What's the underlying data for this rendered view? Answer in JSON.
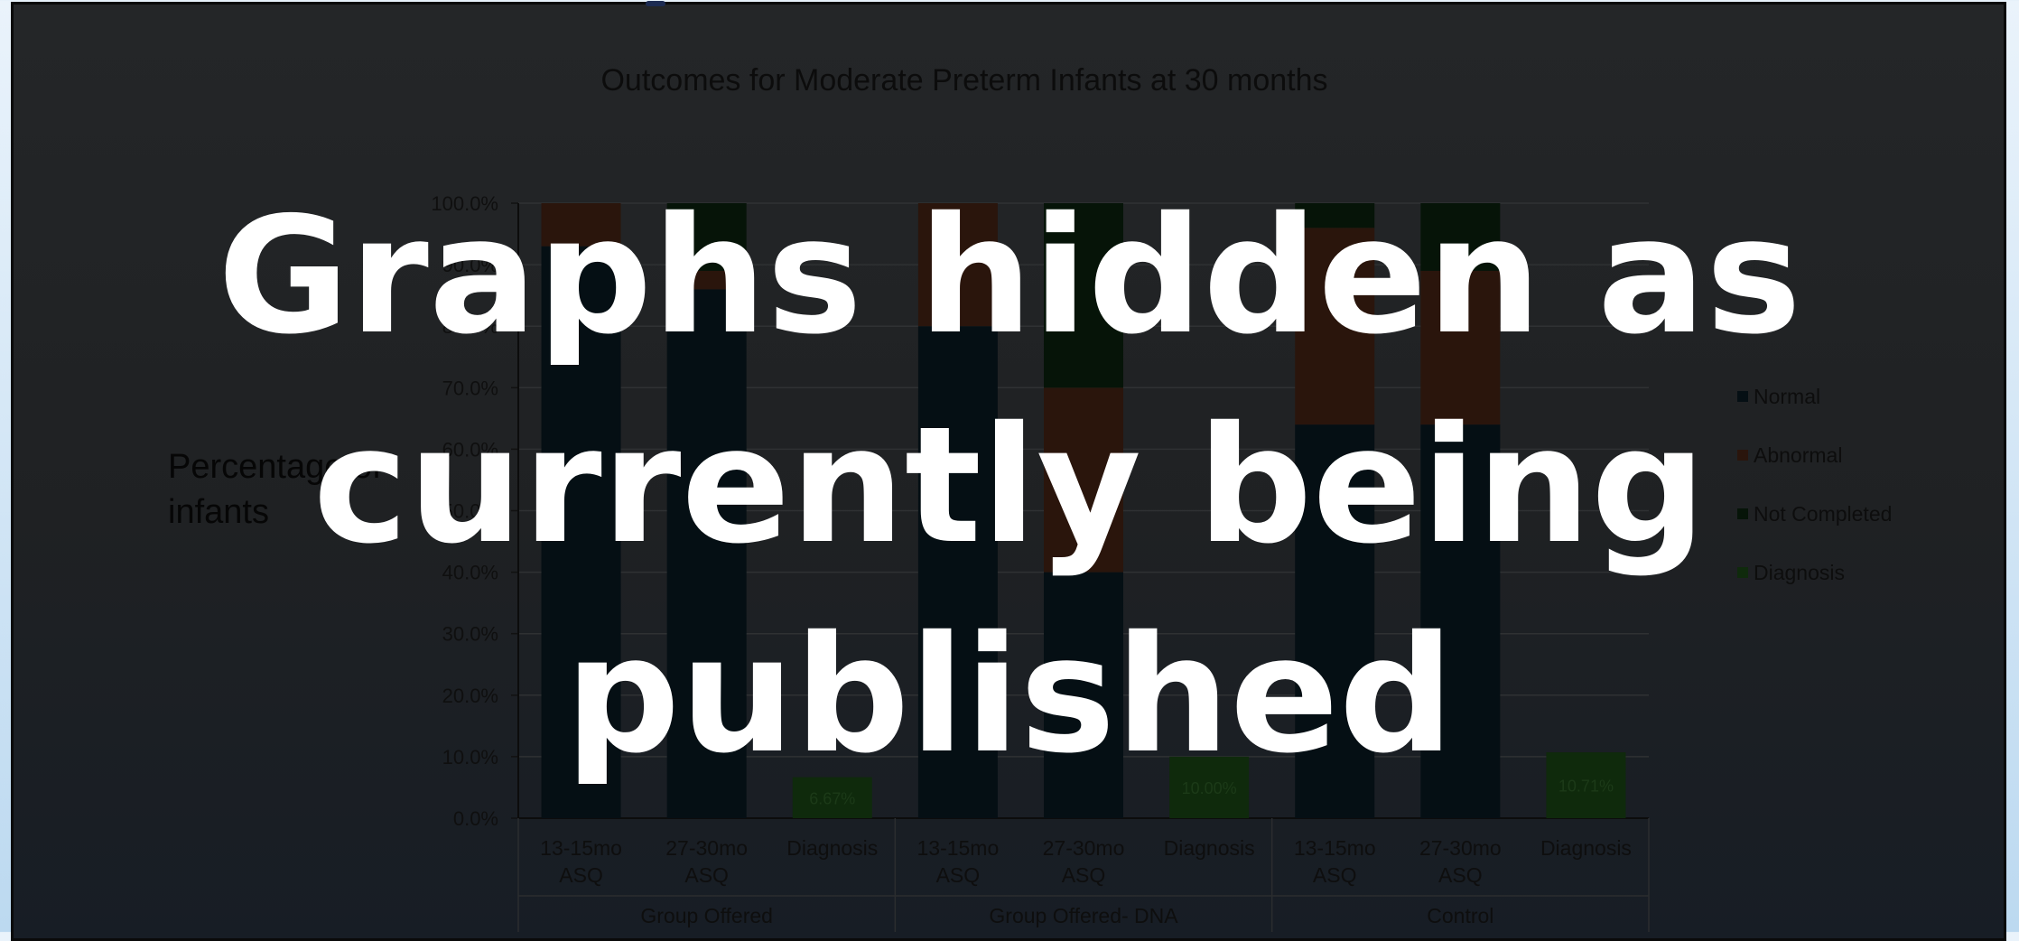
{
  "slide": {
    "overlay_lines": [
      "Graphs hidden as",
      "currently being",
      "published"
    ]
  },
  "chart_data": {
    "type": "bar",
    "stacked": true,
    "title": "Outcomes for Moderate Preterm Infants at 30 months",
    "ylabel": "Percentage of infants",
    "ylim": [
      0,
      100
    ],
    "yticks": [
      "0.0%",
      "10.0%",
      "20.0%",
      "30.0%",
      "40.0%",
      "50.0%",
      "60.0%",
      "70.0%",
      "80.0%",
      "90.0%",
      "100.0%"
    ],
    "grid": true,
    "legend_position": "right",
    "groups": [
      "Group Offered",
      "Group Offered- DNA",
      "Control"
    ],
    "categories": [
      "13-15mo ASQ",
      "27-30mo ASQ",
      "Diagnosis",
      "13-15mo ASQ",
      "27-30mo ASQ",
      "Diagnosis",
      "13-15mo ASQ",
      "27-30mo ASQ",
      "Diagnosis"
    ],
    "series": [
      {
        "name": "Normal",
        "color": "#050f14",
        "values": [
          93.0,
          86.0,
          null,
          80.0,
          40.0,
          null,
          64.0,
          64.0,
          null
        ]
      },
      {
        "name": "Abnormal",
        "color": "#2a150c",
        "values": [
          7.0,
          3.0,
          null,
          20.0,
          30.0,
          null,
          32.0,
          25.0,
          null
        ]
      },
      {
        "name": "Not Completed",
        "color": "#061408",
        "values": [
          0.0,
          11.0,
          null,
          0.0,
          30.0,
          null,
          4.0,
          11.0,
          null
        ]
      },
      {
        "name": "Diagnosis",
        "color": "#0f2a0c",
        "values": [
          null,
          null,
          6.67,
          null,
          null,
          10.0,
          null,
          null,
          10.71
        ]
      }
    ],
    "data_labels": [
      "6.67%",
      "10.00%",
      "10.71%"
    ]
  }
}
